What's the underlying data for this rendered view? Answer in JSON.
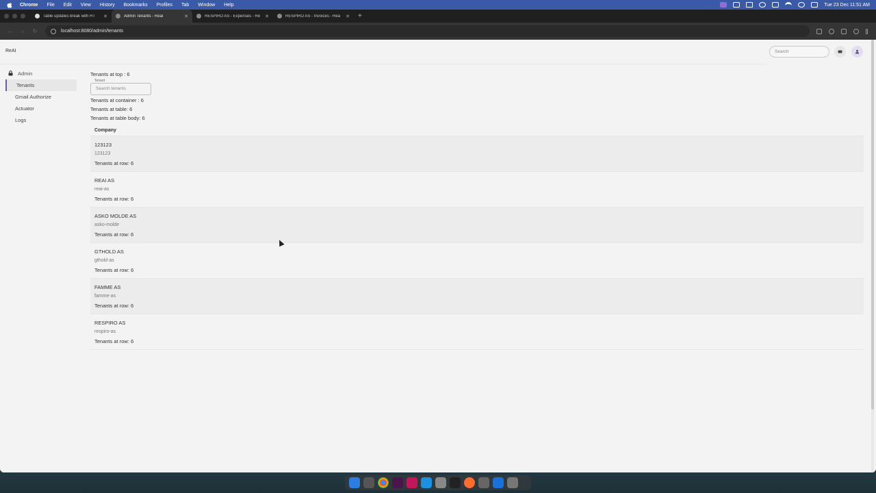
{
  "menubar": {
    "app": "Chrome",
    "items": [
      "File",
      "Edit",
      "View",
      "History",
      "Bookmarks",
      "Profiles",
      "Tab",
      "Window",
      "Help"
    ],
    "clock": "Tue 23 Dec  11:51 AM"
  },
  "browser": {
    "tabs": [
      {
        "title": "Table updates break with HT",
        "favicon": "github-icon",
        "active": false
      },
      {
        "title": "Admin Tenants - Reai",
        "favicon": "globe-icon",
        "active": true
      },
      {
        "title": "RESPIRO AS - Expenses - Re",
        "favicon": "globe-icon",
        "active": false
      },
      {
        "title": "RESPIRO AS - Invoices - Rea",
        "favicon": "globe-icon",
        "active": false
      }
    ],
    "url": "localhost:8080/admin/tenants"
  },
  "app": {
    "brand": "ReAI",
    "search_placeholder": "Search"
  },
  "sidebar": {
    "header": "Admin",
    "items": [
      {
        "label": "Tenants",
        "active": true
      },
      {
        "label": "Gmail Authorize",
        "active": false
      },
      {
        "label": "Actuator",
        "active": false
      },
      {
        "label": "Logs",
        "active": false
      }
    ]
  },
  "main": {
    "tenants_top": "Tenants at top : 6",
    "field_label": "Tenant",
    "field_placeholder": "Search tenants",
    "tenants_container": "Tenants at container : 6",
    "tenants_table": "Tenants at table: 6",
    "tenants_table_body": "Tenants at table body: 6",
    "column_header": "Company",
    "rows": [
      {
        "name": "123123",
        "slug": "123123",
        "count": "Tenants at row: 6"
      },
      {
        "name": "REAI AS",
        "slug": "reai-as",
        "count": "Tenants at row: 6"
      },
      {
        "name": "ASKO MOLDE AS",
        "slug": "asko-molde",
        "count": "Tenants at row: 6"
      },
      {
        "name": "GTHOLD AS",
        "slug": "gthold-as",
        "count": "Tenants at row: 6"
      },
      {
        "name": "FAMME AS",
        "slug": "famme-as",
        "count": "Tenants at row: 6"
      },
      {
        "name": "RESPIRO AS",
        "slug": "respiro-as",
        "count": "Tenants at row: 6"
      }
    ]
  },
  "colors": {
    "menubar": "#3a5aa8",
    "active_accent": "#6a5aaa",
    "page_bg": "#f3f3f3"
  }
}
